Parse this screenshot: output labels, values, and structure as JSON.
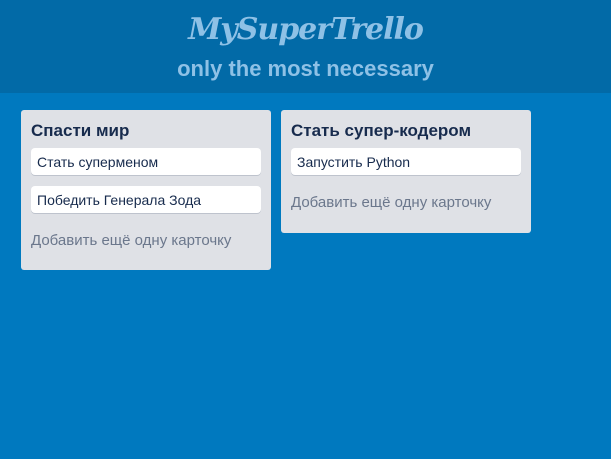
{
  "header": {
    "logo_text": "MySuperTrello",
    "subtitle": "only the most necessary"
  },
  "lists": [
    {
      "title": "Спасти мир",
      "cards": [
        "Стать суперменом",
        "Победить Генерала Зода"
      ],
      "add_card_label": "Добавить ещё одну карточку"
    },
    {
      "title": "Стать супер-кодером",
      "cards": [
        "Запустить Python"
      ],
      "add_card_label": "Добавить ещё одну карточку"
    }
  ],
  "colors": {
    "background": "#0079bf",
    "header": "#026aa7",
    "logo": "#8ec1e6",
    "list_bg": "#dfe1e6",
    "card_bg": "#ffffff"
  }
}
